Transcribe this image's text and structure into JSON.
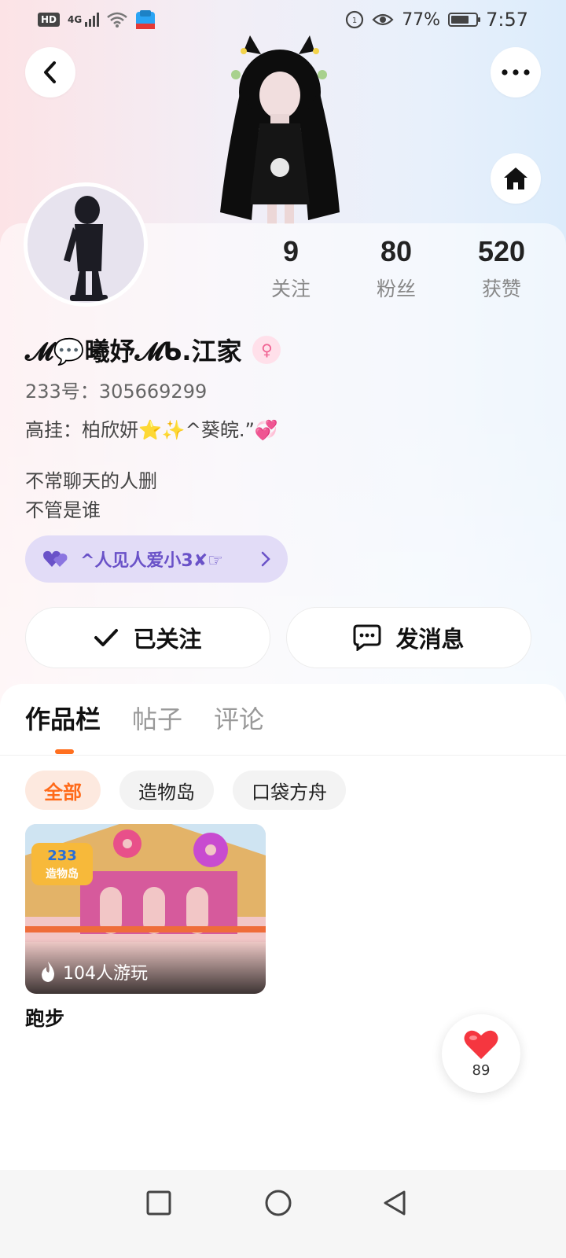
{
  "status_bar": {
    "network_badge": "HD",
    "network_type": "4G",
    "battery_percent": "77%",
    "time": "7:57"
  },
  "header": {
    "back_icon": "chevron-left-icon",
    "more_icon": "more-dots-icon",
    "home_icon": "home-icon"
  },
  "profile": {
    "stats": [
      {
        "value": "9",
        "label": "关注"
      },
      {
        "value": "80",
        "label": "粉丝"
      },
      {
        "value": "520",
        "label": "获赞"
      }
    ],
    "username": "𝓜💬曦妤𝓜ᑲ.江家",
    "gender_symbol": "♀",
    "id_line": "233号：305669299",
    "pinned_line": "高挂：柏欣妍⭐✨^葵皖.”💞",
    "bio_line1": "不常聊天的人删",
    "bio_line2": "不管是谁",
    "chip_label": "^人见人爱小3✘☞",
    "chip_icon": "heart-icon"
  },
  "actions": {
    "follow_label": "已关注",
    "message_label": "发消息"
  },
  "tabs": [
    {
      "label": "作品栏",
      "active": true
    },
    {
      "label": "帖子",
      "active": false
    },
    {
      "label": "评论",
      "active": false
    }
  ],
  "filters": [
    {
      "label": "全部",
      "active": true
    },
    {
      "label": "造物岛",
      "active": false
    },
    {
      "label": "口袋方舟",
      "active": false
    }
  ],
  "works": [
    {
      "badge_number": "233",
      "badge_text": "造物岛",
      "plays": "104人游玩",
      "title": "跑步"
    }
  ],
  "like_button": {
    "count": "89",
    "icon": "heart-icon"
  },
  "colors": {
    "accent_orange": "#ff6a1a",
    "chip_purple": "#6a52c8",
    "chip_bg": "#e2dcf7",
    "like_red": "#f5363f"
  }
}
